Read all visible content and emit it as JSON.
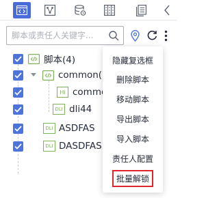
{
  "toolbar": {
    "tabs": [
      {
        "name": "code-tab",
        "active": true
      },
      {
        "name": "flow-tab",
        "active": false
      },
      {
        "name": "database-tab",
        "active": false
      },
      {
        "name": "grid-tab",
        "active": false
      },
      {
        "name": "document-tab",
        "active": false
      }
    ],
    "collapse_icon": "chevron-left-icon"
  },
  "search": {
    "placeholder": "脚本或责任人关键字..."
  },
  "tree": {
    "root": {
      "label": "脚本(4)",
      "checked": true,
      "expanded": true
    },
    "folder": {
      "label": "common(2",
      "checked": true,
      "expanded": true
    },
    "items": [
      {
        "label": "commo",
        "badge": "Hi",
        "checked": true
      },
      {
        "label": "dli44",
        "badge": "DLI",
        "checked": true
      },
      {
        "label": "ASDFAS",
        "badge": "DLI",
        "checked": true
      },
      {
        "label": "DASDFAS",
        "badge": "DLI",
        "checked": true
      }
    ]
  },
  "menu": {
    "items": [
      {
        "label": "隐藏复选框"
      },
      {
        "label": "删除脚本"
      },
      {
        "label": "移动脚本"
      },
      {
        "label": "导出脚本"
      },
      {
        "label": "导入脚本"
      },
      {
        "label": "责任人配置"
      },
      {
        "label": "批量解锁",
        "highlighted": true
      }
    ]
  },
  "colors": {
    "accent": "#4d74db",
    "active_tab": "#4a6cd8",
    "file_green": "#7fb158",
    "highlight_border": "#e0242b"
  }
}
